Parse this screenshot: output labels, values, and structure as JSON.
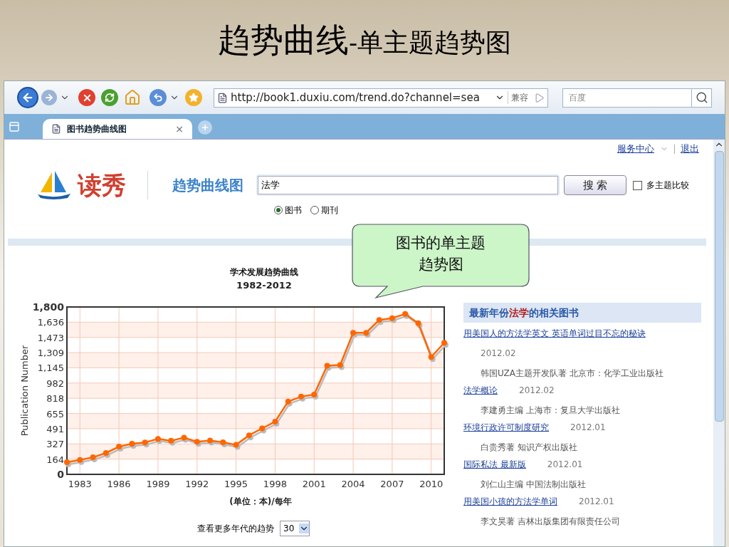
{
  "slide": {
    "title": "趋势曲线",
    "subtitle": "-单主题趋势图"
  },
  "browser": {
    "url": "http://book1.duxiu.com/trend.do?channel=sea",
    "compat_label": "兼容",
    "search_placeholder": "百度",
    "tabs": [
      {
        "label": "图书趋势曲线图",
        "selected": true,
        "close": "×"
      }
    ]
  },
  "page": {
    "top_links": [
      "服务中心",
      "退出"
    ],
    "logo": "读秀",
    "section_title": "趋势曲线图",
    "search": {
      "value": "法学",
      "button": "搜 索"
    },
    "compare": {
      "label": "多主题比较",
      "checked": false
    },
    "types": [
      {
        "label": "图书",
        "selected": true
      },
      {
        "label": "期刊",
        "selected": false
      }
    ],
    "callout": "图书的单主题趋势图",
    "chart": {
      "title": "学术发展趋势曲线",
      "range": "1982-2012",
      "unit": "(单位：本)/每年",
      "chart_data": {
        "type": "line",
        "ylabel": "Publication Number",
        "x": [
          1982,
          1983,
          1984,
          1985,
          1986,
          1987,
          1988,
          1989,
          1990,
          1991,
          1992,
          1993,
          1994,
          1995,
          1996,
          1997,
          1998,
          1999,
          2000,
          2001,
          2002,
          2003,
          2004,
          2005,
          2006,
          2007,
          2008,
          2009,
          2010,
          2011
        ],
        "grid": true,
        "series": [
          {
            "color": "#ff6600",
            "marker": true,
            "values": [
              131,
              155,
              183,
              230,
              298,
              330,
              342,
              382,
              361,
              395,
              351,
              364,
              345,
              317,
              420,
              494,
              566,
              783,
              836,
              858,
              1169,
              1175,
              1523,
              1523,
              1660,
              1679,
              1725,
              1626,
              1262,
              1415
            ]
          }
        ],
        "xlim": [
          1982,
          2011
        ],
        "ylim": [
          0,
          1800
        ],
        "xticks": [
          1983,
          1986,
          1989,
          1992,
          1995,
          1998,
          2001,
          2004,
          2007,
          2010
        ],
        "yticks": [
          {
            "value": 0,
            "label": "0"
          },
          {
            "value": 163.6,
            "label": "164"
          },
          {
            "value": 327.3,
            "label": "327"
          },
          {
            "value": 490.9,
            "label": "491"
          },
          {
            "value": 654.5,
            "label": "655"
          },
          {
            "value": 818.2,
            "label": "818"
          },
          {
            "value": 981.8,
            "label": "982"
          },
          {
            "value": 1145.5,
            "label": "1,145"
          },
          {
            "value": 1309.1,
            "label": "1,309"
          },
          {
            "value": 1472.7,
            "label": "1,473"
          },
          {
            "value": 1636.4,
            "label": "1,636"
          },
          {
            "value": 1800,
            "label": "1,800"
          }
        ]
      }
    },
    "more": {
      "label": "查看更多年代的趋势",
      "value": "30"
    },
    "books": {
      "heading_before": "最新年份",
      "keyword": "法学",
      "heading_after": "的相关图书",
      "items": [
        {
          "kind": "long",
          "title": "用美国人的方法学英文 英语单词过目不忘的秘诀",
          "date": "2012.02",
          "meta": "韩国UZA主题开发队著 北京市：化学工业出版社"
        },
        {
          "kind": "short",
          "title": "法学概论",
          "date": "2012.02",
          "meta": "李建勇主编 上海市：复旦大学出版社"
        },
        {
          "kind": "short",
          "title": "环境行政许可制度研究",
          "date": "2012.01",
          "meta": "白贵秀著 知识产权出版社"
        },
        {
          "kind": "short",
          "title": "国际私法 最新版",
          "date": "2012.01",
          "meta": "刘仁山主编 中国法制出版社"
        },
        {
          "kind": "short",
          "title": "用美国小孩的方法学单词",
          "date": "2012.01",
          "meta": "李文昊著 吉林出版集团有限责任公司"
        }
      ]
    }
  }
}
